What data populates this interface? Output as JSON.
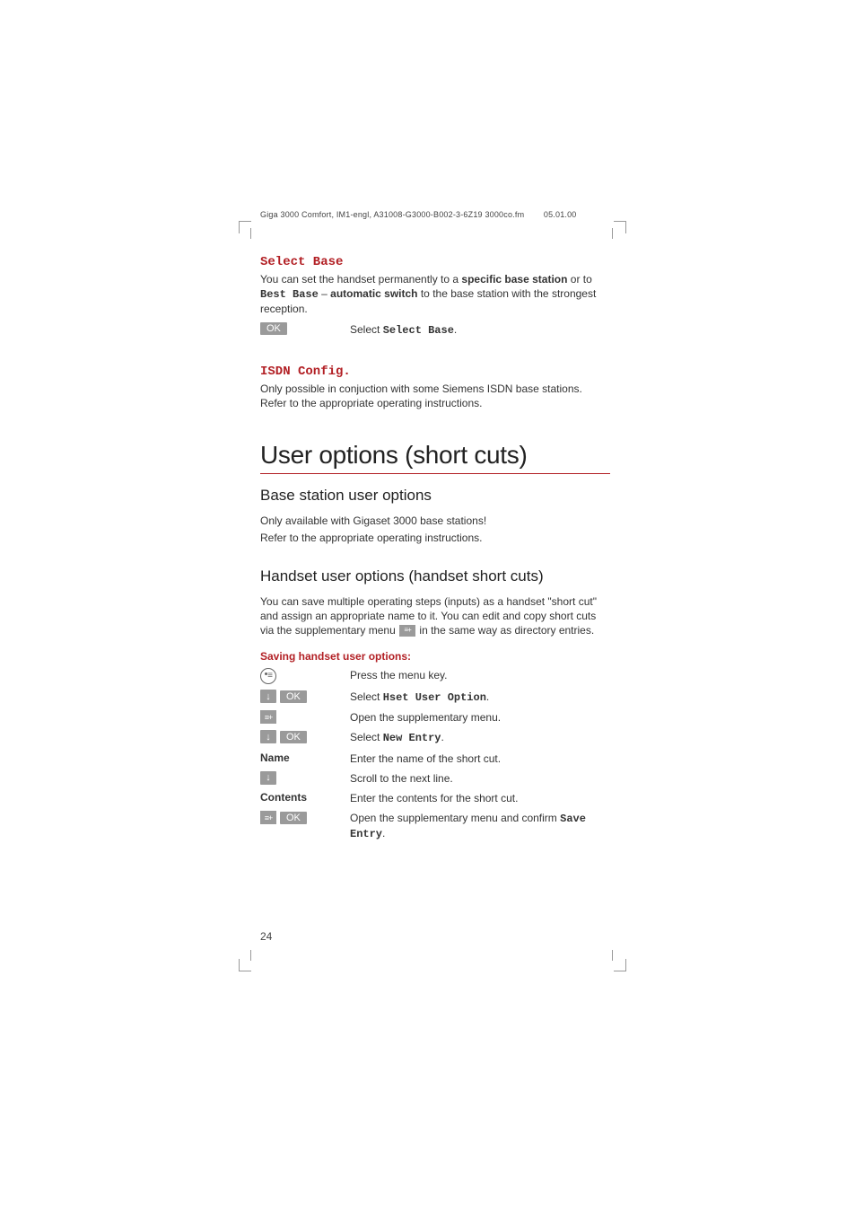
{
  "header": "Giga 3000 Comfort, IM1-engl, A31008-G3000-B002-3-6Z19  3000co.fm",
  "header_date": "05.01.00",
  "select_base": {
    "title": "Select Base",
    "p1a": "You can set the handset permanently to a ",
    "p1b": "specific base station",
    "p1c": " or to  ",
    "p1d": "Best Base",
    "p1e": " – ",
    "p1f": "automatic switch",
    "p1g": " to the base station with the strongest reception.",
    "ok": "OK",
    "select_a": "Select ",
    "select_b": "Select Base",
    "select_c": "."
  },
  "isdn": {
    "title": "ISDN Config.",
    "p": "Only possible in conjuction with some Siemens ISDN base stations. Refer to the appropriate operating instructions."
  },
  "main_title": "User options (short cuts)",
  "base_opts": {
    "title": "Base station user options",
    "l1": "Only available with Gigaset 3000 base stations!",
    "l2": "Refer to the appropriate operating instructions."
  },
  "hs_opts": {
    "title": "Handset user options (handset short cuts)",
    "p_a": "You can save multiple operating steps (inputs) as a handset \"short cut\" and assign an appropriate name to it. You can edit and copy short cuts via the supplementary menu ",
    "p_b": " in the same way as directory entries."
  },
  "saving": {
    "header": "Saving handset user options:",
    "r1": "Press the menu key.",
    "r2a": "Select ",
    "r2b": "Hset User Option",
    "r2c": ".",
    "r3": "Open the supplementary menu.",
    "r4a": "Select ",
    "r4b": "New Entry",
    "r4c": ".",
    "r5_label": "Name",
    "r5": "Enter the name of the short cut.",
    "r6": "Scroll to the next line.",
    "r7_label": "Contents",
    "r7": "Enter the contents for the short cut.",
    "r8a": "Open the supplementary menu and confirm ",
    "r8b": "Save Entry",
    "r8c": ".",
    "ok": "OK"
  },
  "page_number": "24"
}
